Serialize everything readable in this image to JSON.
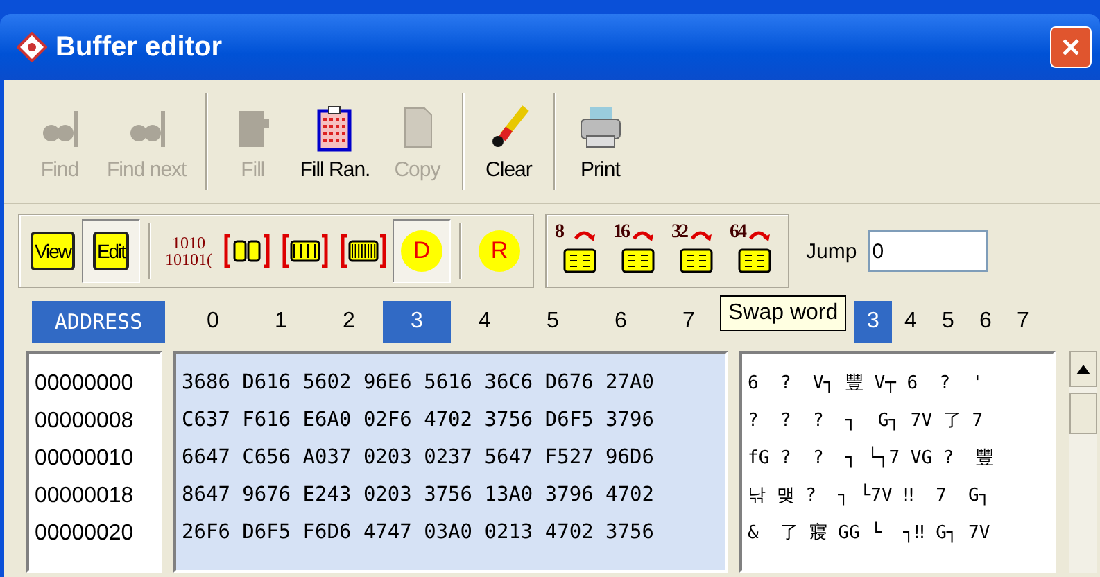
{
  "window": {
    "title": "Buffer editor"
  },
  "toolbar": [
    {
      "label": "Find",
      "disabled": true,
      "kind": "find"
    },
    {
      "label": "Find next",
      "disabled": true,
      "kind": "findnext"
    },
    {
      "label": "Fill",
      "disabled": true,
      "kind": "fill",
      "separator_before": true
    },
    {
      "label": "Fill Ran.",
      "disabled": false,
      "kind": "fillran"
    },
    {
      "label": "Copy",
      "disabled": true,
      "kind": "copy"
    },
    {
      "label": "Clear",
      "disabled": false,
      "kind": "clear",
      "separator_before": true
    },
    {
      "label": "Print",
      "disabled": false,
      "kind": "print",
      "separator_before": true
    }
  ],
  "mode_buttons": [
    {
      "label": "View",
      "selected": false
    },
    {
      "label": "Edit",
      "selected": true
    }
  ],
  "format_buttons": [
    {
      "kind": "bits",
      "label": "1010\n10101(",
      "selected": false
    },
    {
      "kind": "byte",
      "selected": false
    },
    {
      "kind": "word",
      "selected": false
    },
    {
      "kind": "dword",
      "selected": false
    },
    {
      "kind": "circle",
      "label": "D",
      "selected": true
    }
  ],
  "r_button": {
    "label": "R",
    "selected": false
  },
  "swap_buttons": [
    {
      "label": "8"
    },
    {
      "label": "16"
    },
    {
      "label": "32"
    },
    {
      "label": "64"
    }
  ],
  "jump": {
    "label": "Jump",
    "value": "0"
  },
  "header": {
    "address": "ADDRESS",
    "hex_columns": [
      {
        "label": "0",
        "selected": false
      },
      {
        "label": "1",
        "selected": false
      },
      {
        "label": "2",
        "selected": false
      },
      {
        "label": "3",
        "selected": true
      },
      {
        "label": "4",
        "selected": false
      },
      {
        "label": "5",
        "selected": false
      },
      {
        "label": "6",
        "selected": false
      },
      {
        "label": "7",
        "selected": false
      }
    ],
    "text_columns": [
      {
        "label": "3",
        "selected": true
      },
      {
        "label": "4",
        "selected": false
      },
      {
        "label": "5",
        "selected": false
      },
      {
        "label": "6",
        "selected": false
      },
      {
        "label": "7",
        "selected": false
      }
    ]
  },
  "tooltip": "Swap word",
  "rows": [
    {
      "address": "00000000",
      "hex": "3686 D616 5602 96E6 5616 36C6 D676 27A0",
      "text": "6  ?  V┐ 豐 V┬ 6  ?  '"
    },
    {
      "address": "00000008",
      "hex": "C637 F616 E6A0 02F6 4702 3756 D6F5 3796",
      "text": "?  ?  ?  ┐  G┐ 7V 了 7"
    },
    {
      "address": "00000010",
      "hex": "6647 C656 A037 0203 0237 5647 F527 96D6",
      "text": "fG ?  ?  ┐ └┐7 VG ?  豐"
    },
    {
      "address": "00000018",
      "hex": "8647 9676 E243 0203 3756 13A0 3796 4702",
      "text": "낚 맺 ?  ┐ └7V ‼  7  G┐"
    },
    {
      "address": "00000020",
      "hex": "26F6 D6F5 F6D6 4747 03A0 0213 4702 3756",
      "text": "&  了 寢 GG └  ┐‼ G┐ 7V"
    }
  ]
}
